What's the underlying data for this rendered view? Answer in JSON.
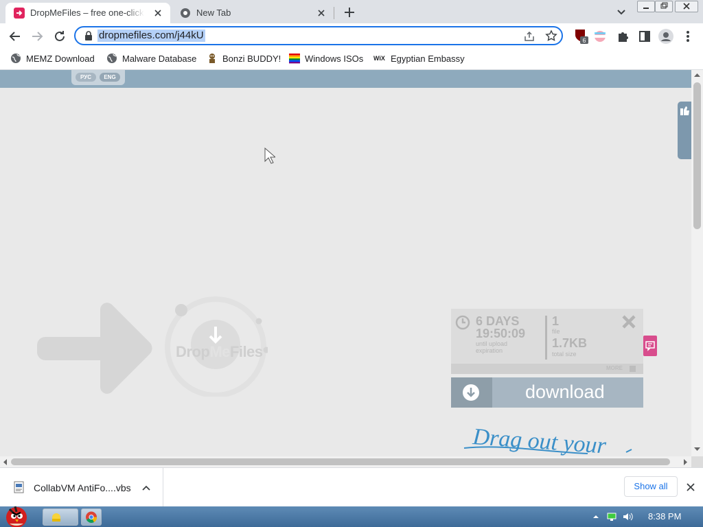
{
  "browser": {
    "tabs": [
      {
        "title": "DropMeFiles – free one-click f",
        "active": true
      },
      {
        "title": "New Tab",
        "active": false
      }
    ],
    "url": "dropmefiles.com/j44kU",
    "extension_badge": "6",
    "bookmarks": [
      {
        "label": "MEMZ Download",
        "icon": "globe-icon"
      },
      {
        "label": "Malware Database",
        "icon": "globe-icon"
      },
      {
        "label": "Bonzi BUDDY!",
        "icon": "bonzi-icon"
      },
      {
        "label": "Windows ISOs",
        "icon": "rainbow-flag-icon"
      },
      {
        "label": "Egyptian Embassy",
        "icon": "wix-icon"
      }
    ],
    "wix_text": "WiX"
  },
  "site": {
    "languages": [
      "РУС",
      "ENG"
    ],
    "logo": {
      "part1": "Drop",
      "part2": "Me",
      "part3": "Files"
    },
    "expiry": {
      "days": "6 DAYS",
      "time": "19:50:09",
      "label": "until upload expiration"
    },
    "files": {
      "count": "1",
      "label": "file"
    },
    "size": {
      "value": "1.7KB",
      "label": "total size"
    },
    "more_label": "MORE",
    "download_label": "download",
    "drag_text": "Drag out your"
  },
  "downloads": {
    "file_name": "CollabVM AntiFo....vbs",
    "show_all": "Show all"
  },
  "taskbar": {
    "clock": "8:38 PM"
  },
  "colors": {
    "accent": "#1a73e8",
    "site_header": "#8eaabd",
    "download_button": "#a7b6c2",
    "feedback_tab": "#d84d8d",
    "drag_text": "#3a8fc8"
  }
}
